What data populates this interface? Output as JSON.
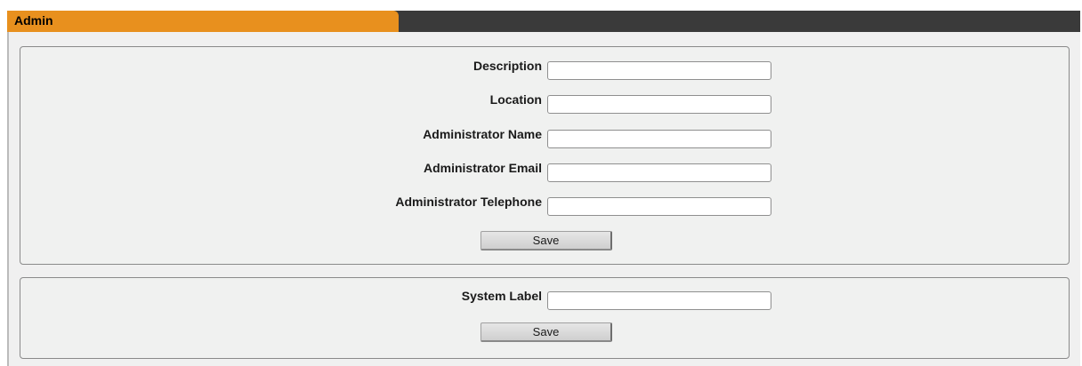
{
  "header": {
    "tab_label": "Admin"
  },
  "admin_panel": {
    "fields": [
      {
        "label": "Description",
        "value": ""
      },
      {
        "label": "Location",
        "value": ""
      },
      {
        "label": "Administrator Name",
        "value": ""
      },
      {
        "label": "Administrator Email",
        "value": ""
      },
      {
        "label": "Administrator Telephone",
        "value": ""
      }
    ],
    "save_label": "Save"
  },
  "system_panel": {
    "fields": [
      {
        "label": "System Label",
        "value": ""
      }
    ],
    "save_label": "Save"
  },
  "colors": {
    "tab_accent": "#e8901e",
    "tab_bar": "#3a3a3a",
    "panel_background": "#f0f1f0"
  }
}
